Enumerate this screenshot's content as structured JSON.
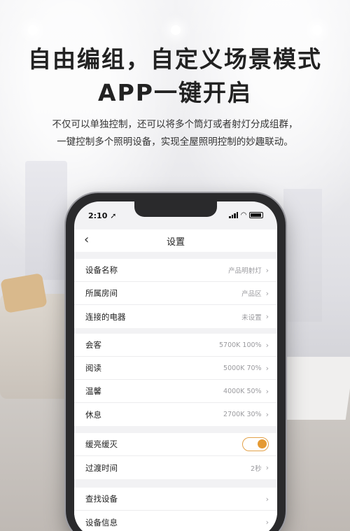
{
  "headline": {
    "line1": "自由编组，自定义场景模式",
    "line2": "APP一键开启"
  },
  "subtitle": {
    "line1": "不仅可以单独控制，还可以将多个筒灯或者射灯分成组群，",
    "line2": "一键控制多个照明设备，实现全屋照明控制的妙趣联动。"
  },
  "phone": {
    "status_time": "2:10",
    "nav_title": "设置",
    "back_icon": "chevron-left-icon",
    "group1": [
      {
        "label": "设备名称",
        "value": "产品明射灯"
      },
      {
        "label": "所属房间",
        "value": "产品区"
      },
      {
        "label": "连接的电器",
        "value": "未设置"
      }
    ],
    "group2": [
      {
        "label": "会客",
        "value": "5700K 100%"
      },
      {
        "label": "阅读",
        "value": "5000K 70%"
      },
      {
        "label": "温馨",
        "value": "4000K 50%"
      },
      {
        "label": "休息",
        "value": "2700K 30%"
      }
    ],
    "group3": {
      "fade_label": "缓亮缓灭",
      "fade_enabled": true,
      "transition_label": "过渡时间",
      "transition_value": "2秒"
    },
    "group4": [
      {
        "label": "查找设备"
      },
      {
        "label": "设备信息"
      }
    ],
    "accent_color": "#e59a33"
  }
}
